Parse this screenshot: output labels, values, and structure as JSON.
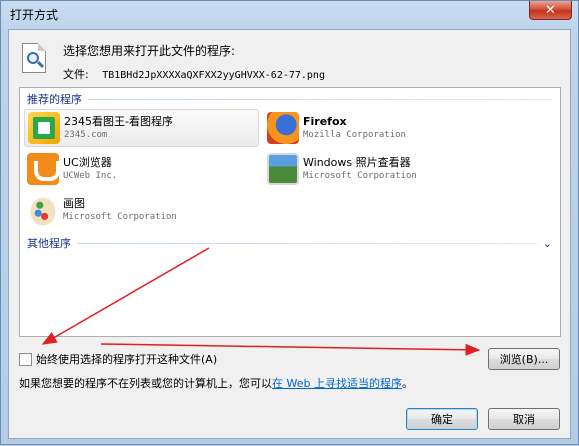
{
  "window": {
    "title": "打开方式",
    "close_glyph": "✕"
  },
  "header": {
    "prompt": "选择您想用来打开此文件的程序:",
    "file_label": "文件:",
    "file_name": "TB1BHd2JpXXXXaQXFXX2yyGHVXX-62-77.png"
  },
  "recommended": {
    "label": "推荐的程序",
    "programs": [
      {
        "name": "2345看图王-看图程序",
        "company": "2345.com",
        "icon": "2345-viewer-icon",
        "selected": true
      },
      {
        "name": "Firefox",
        "company": "Mozilla Corporation",
        "icon": "firefox-icon",
        "selected": false
      },
      {
        "name": "UC浏览器",
        "company": "UCWeb Inc.",
        "icon": "uc-browser-icon",
        "selected": false
      },
      {
        "name": "Windows 照片查看器",
        "company": "Microsoft Corporation",
        "icon": "photo-viewer-icon",
        "selected": false
      },
      {
        "name": "画图",
        "company": "Microsoft Corporation",
        "icon": "paint-icon",
        "selected": false
      }
    ]
  },
  "other": {
    "label": "其他程序",
    "chevron": "⌄"
  },
  "always_use": {
    "label": "始终使用选择的程序打开这种文件(A)",
    "checked": false
  },
  "browse_label": "浏览(B)...",
  "info": {
    "prefix": "如果您想要的程序不在列表或您的计算机上，您可以",
    "link": "在 Web 上寻找适当的程序",
    "suffix": "。"
  },
  "buttons": {
    "ok": "确定",
    "cancel": "取消"
  },
  "colors": {
    "annotation_arrow": "#e02020",
    "link": "#0066cc",
    "group_header": "#1e3287"
  }
}
